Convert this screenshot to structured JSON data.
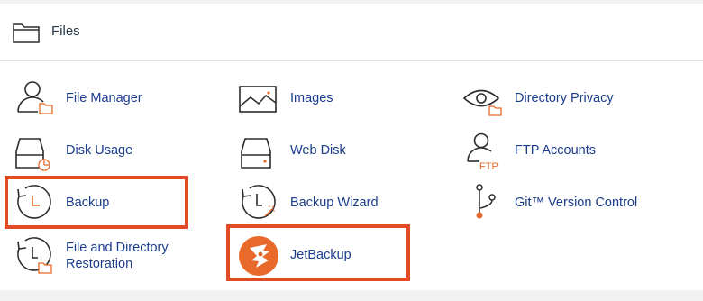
{
  "section": {
    "title": "Files",
    "icon": "folder-icon"
  },
  "items": [
    {
      "label": "File Manager",
      "icon": "file-manager-icon"
    },
    {
      "label": "Images",
      "icon": "images-icon"
    },
    {
      "label": "Directory Privacy",
      "icon": "eye-icon"
    },
    {
      "label": "Disk Usage",
      "icon": "disk-usage-icon"
    },
    {
      "label": "Web Disk",
      "icon": "web-disk-icon"
    },
    {
      "label": "FTP Accounts",
      "icon": "ftp-accounts-icon"
    },
    {
      "label": "Backup",
      "icon": "backup-clock-icon"
    },
    {
      "label": "Backup Wizard",
      "icon": "backup-wizard-icon"
    },
    {
      "label": "Git™ Version Control",
      "icon": "git-icon"
    },
    {
      "label": "File and Directory Restoration",
      "icon": "restoration-icon"
    },
    {
      "label": "JetBackup",
      "icon": "jetbackup-logo-icon"
    }
  ],
  "colors": {
    "accent_orange": "#e8692a",
    "link_blue": "#1a3c8c",
    "highlight_red": "#e04b26",
    "icon_dark": "#2b2b2b"
  }
}
